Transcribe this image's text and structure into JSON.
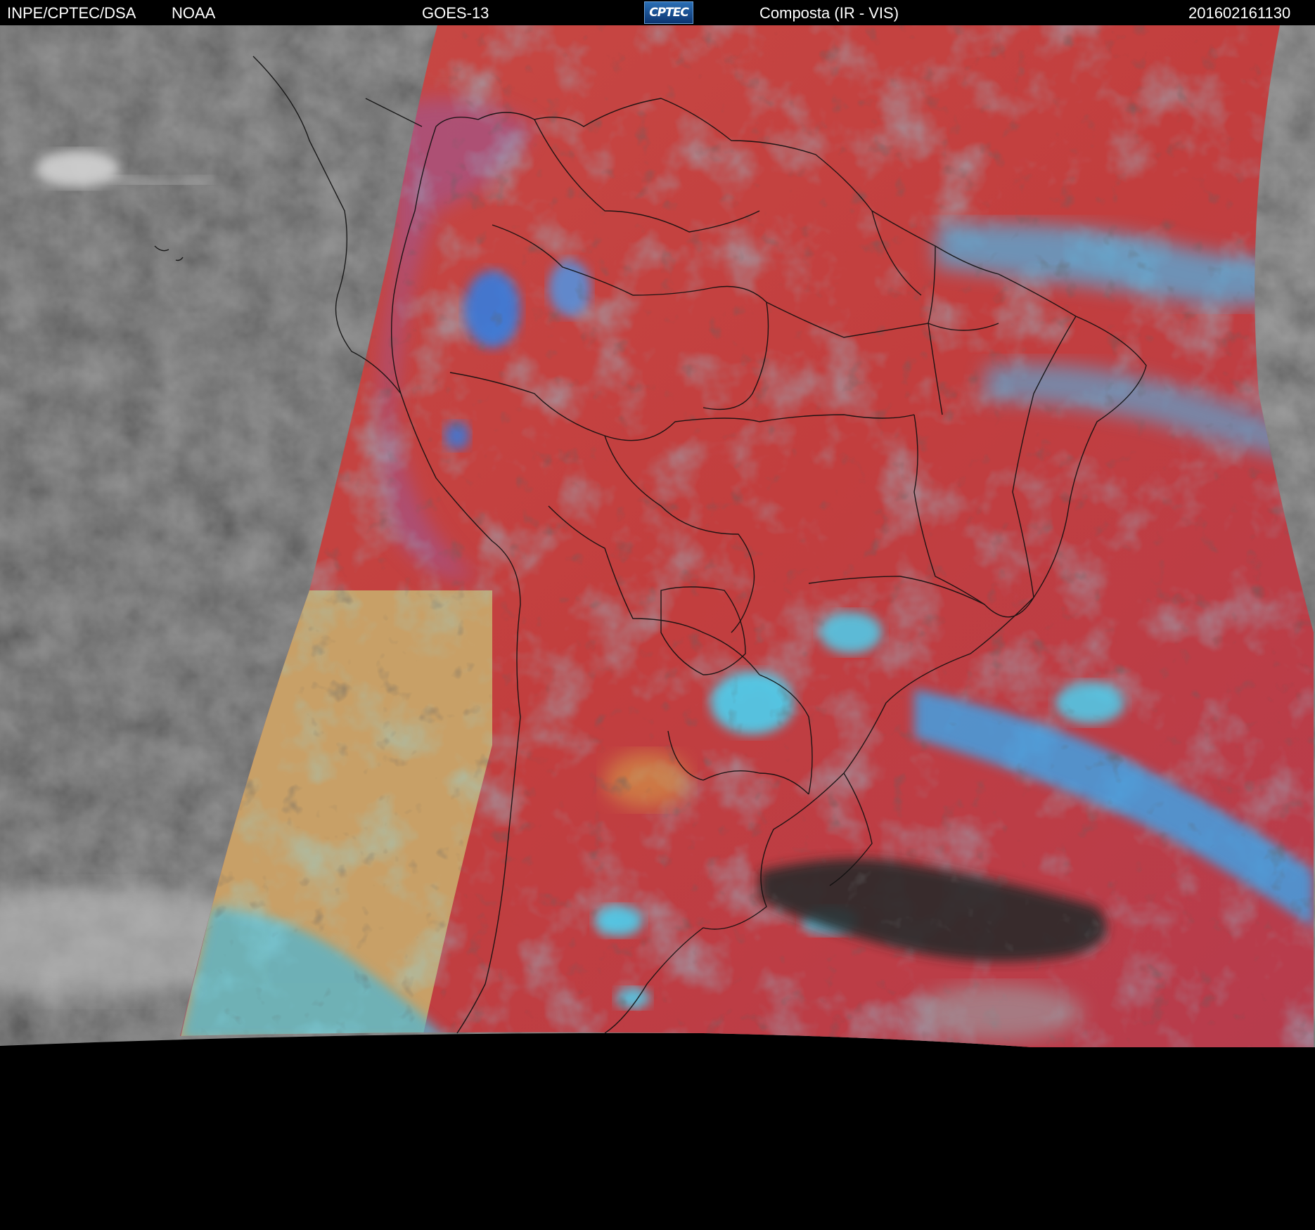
{
  "header": {
    "source": "INPE/CPTEC/DSA",
    "agency": "NOAA",
    "satellite": "GOES-13",
    "logo_text": "CPTEC",
    "product": "Composta (IR - VIS)",
    "timestamp": "201602161130"
  },
  "colors": {
    "background": "#000000",
    "land_red": "#c43f3f",
    "ocean_red": "#cc4a3e",
    "cloud_cyan": "#3fc6ee",
    "cloud_blue": "#2f7fe6",
    "desert_yellow": "#c8b46a",
    "night_gray": "#3a3a3a",
    "border_line": "#111111"
  },
  "icons": [
    "cptec-logo-icon"
  ]
}
